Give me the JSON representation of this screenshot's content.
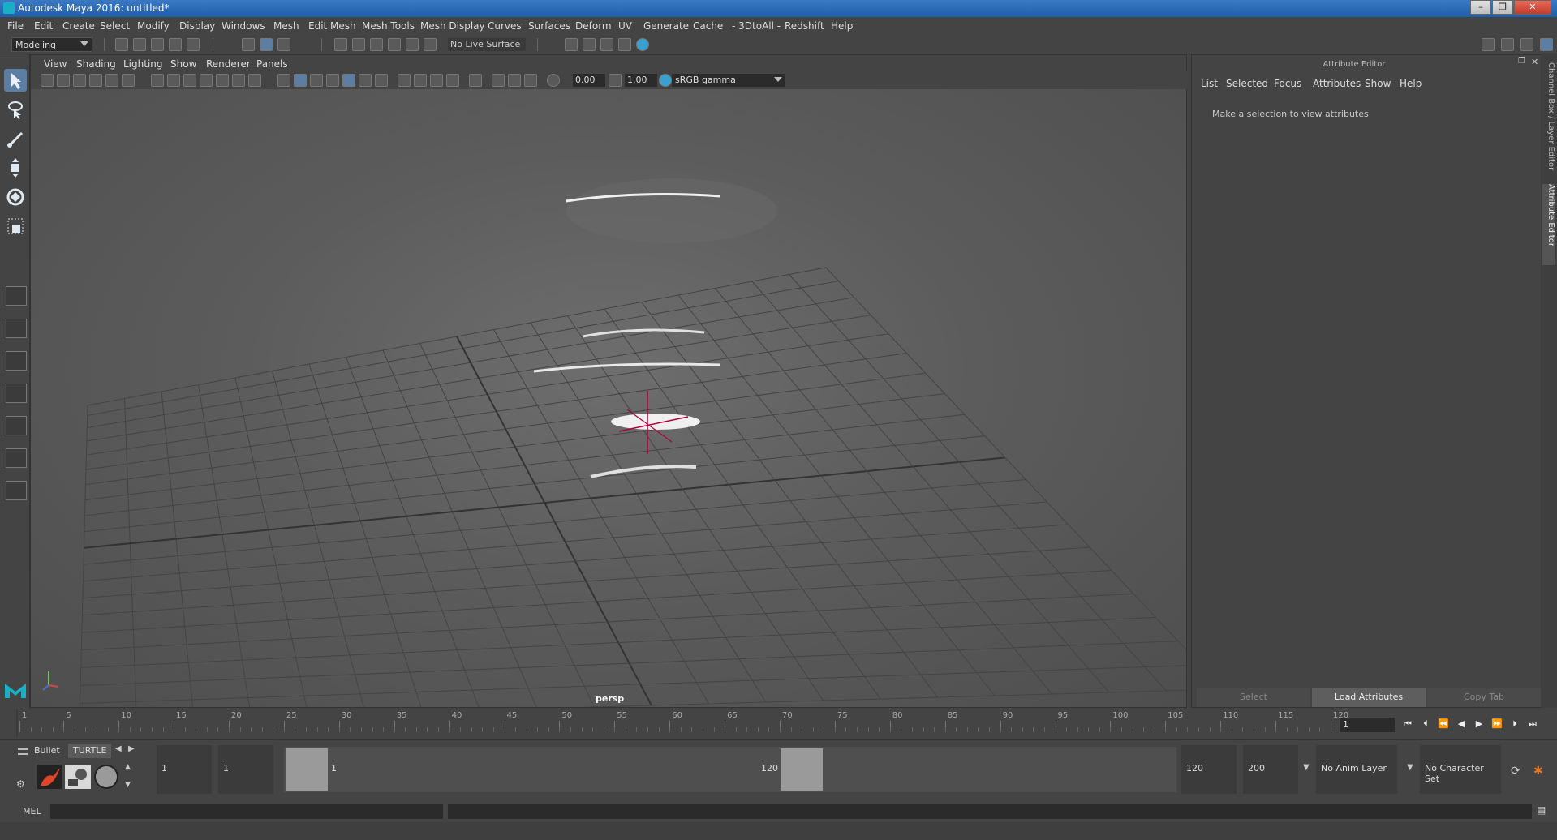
{
  "window": {
    "title": "Autodesk Maya 2016: untitled*"
  },
  "menu": [
    "File",
    "Edit",
    "Create",
    "Select",
    "Modify",
    "Display",
    "Windows",
    "Mesh",
    "Edit Mesh",
    "Mesh Tools",
    "Mesh Display",
    "Curves",
    "Surfaces",
    "Deform",
    "UV",
    "Generate",
    "Cache",
    "- 3DtoAll -",
    "Redshift",
    "Help"
  ],
  "status_line": {
    "mode": "Modeling",
    "live_surface": "No Live Surface"
  },
  "viewport": {
    "panel_menu": [
      "View",
      "Shading",
      "Lighting",
      "Show",
      "Renderer",
      "Panels"
    ],
    "exposure": "0.00",
    "gamma": "1.00",
    "color_space": "sRGB gamma",
    "camera": "persp"
  },
  "attribute_editor": {
    "title": "Attribute Editor",
    "menu": [
      "List",
      "Selected",
      "Focus",
      "Attributes",
      "Show",
      "Help"
    ],
    "message": "Make a selection to view attributes",
    "buttons": {
      "select": "Select",
      "load": "Load Attributes",
      "copy": "Copy Tab"
    }
  },
  "side_tabs": {
    "channel_box": "Channel Box / Layer Editor",
    "attribute_editor": "Attribute Editor"
  },
  "time_slider": {
    "ticks": [
      "1",
      "5",
      "10",
      "15",
      "20",
      "25",
      "30",
      "35",
      "40",
      "45",
      "50",
      "55",
      "60",
      "65",
      "70",
      "75",
      "80",
      "85",
      "90",
      "95",
      "100",
      "105",
      "110",
      "115",
      "120"
    ],
    "current_frame": "1"
  },
  "shelf": {
    "tabs": [
      "Bullet",
      "TURTLE"
    ]
  },
  "range": {
    "start": "1",
    "playback_start": "1",
    "range_start_label": "1",
    "range_end_label": "120",
    "playback_end": "120",
    "end": "200",
    "anim_layer": "No Anim Layer",
    "character_set": "No Character Set"
  },
  "command_line": {
    "label": "MEL"
  }
}
